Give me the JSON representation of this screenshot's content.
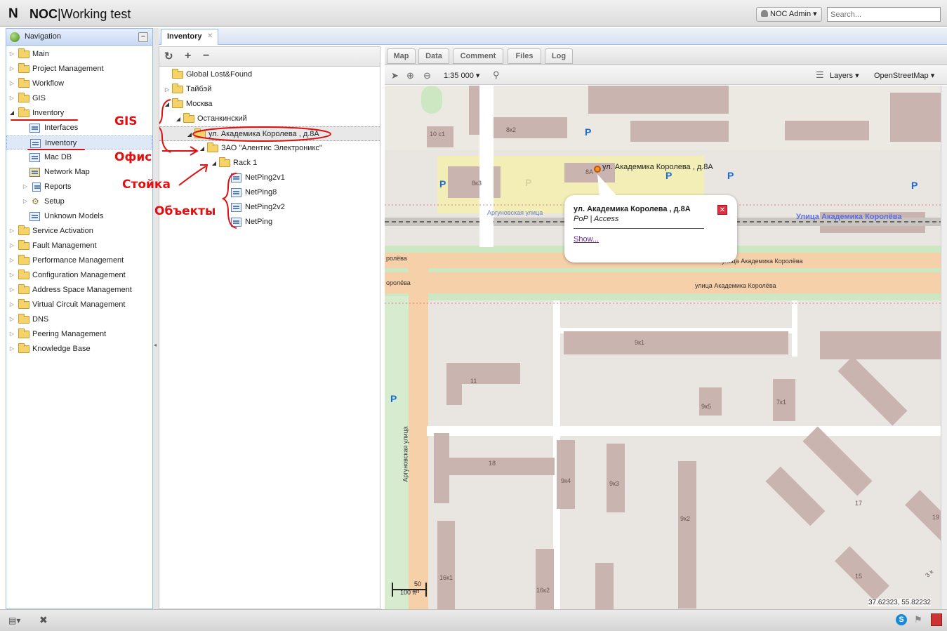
{
  "header": {
    "logo_letter": "N",
    "logo_bold": "NOC",
    "logo_rest": "|Working test",
    "user_label": "NOC Admin ▾",
    "search_placeholder": "Search..."
  },
  "nav": {
    "title": "Navigation",
    "collapse_label": "−",
    "items": [
      {
        "label": "Main"
      },
      {
        "label": "Project Management"
      },
      {
        "label": "Workflow"
      },
      {
        "label": "GIS"
      },
      {
        "label": "Inventory"
      },
      {
        "label": "Interfaces"
      },
      {
        "label": "Inventory"
      },
      {
        "label": "Mac DB"
      },
      {
        "label": "Network Map"
      },
      {
        "label": "Reports"
      },
      {
        "label": "Setup"
      },
      {
        "label": "Unknown Models"
      },
      {
        "label": "Service Activation"
      },
      {
        "label": "Fault Management"
      },
      {
        "label": "Performance Management"
      },
      {
        "label": "Configuration Management"
      },
      {
        "label": "Address Space Management"
      },
      {
        "label": "Virtual Circuit Management"
      },
      {
        "label": "DNS"
      },
      {
        "label": "Peering Management"
      },
      {
        "label": "Knowledge Base"
      }
    ]
  },
  "tab": {
    "label": "Inventory",
    "close": "✕"
  },
  "tree": {
    "tools": {
      "refresh": "↻",
      "add": "+",
      "remove": "−"
    },
    "nodes": [
      {
        "label": "Global Lost&Found"
      },
      {
        "label": "Тайбэй"
      },
      {
        "label": "Москва"
      },
      {
        "label": "Останкинский"
      },
      {
        "label": "ул. Академика Королева , д.8А"
      },
      {
        "label": "ЗАО \"Алентис Электроникс\""
      },
      {
        "label": "Rack 1"
      },
      {
        "label": "NetPing2v1"
      },
      {
        "label": "NetPing8"
      },
      {
        "label": "NetPing2v2"
      },
      {
        "label": "NetPing"
      }
    ]
  },
  "annotations": {
    "gis": "GIS",
    "office": "Офис",
    "rack": "Стойка",
    "objects": "Объекты"
  },
  "right_tabs": [
    "Map",
    "Data",
    "Comment",
    "Files",
    "Log"
  ],
  "map_toolbar": {
    "scale": "1:35 000 ▾",
    "layers": "Layers ▾",
    "base": "OpenStreetMap ▾"
  },
  "map": {
    "labels": {
      "b10c1": "10 с1",
      "b8k2": "8к2",
      "b8k3": "8к3",
      "b8a": "8А",
      "b9k1": "9к1",
      "b11": "11",
      "b9k5": "9к5",
      "b7k1": "7к1",
      "b18": "18",
      "b9k4": "9к4",
      "b9k3": "9к3",
      "b9k2": "9к2",
      "b17": "17",
      "b19": "19",
      "b15": "15",
      "b16k1": "16к1",
      "b16k2": "16к2",
      "b3k": "3 к",
      "street_argun": "Аргуновская улица",
      "street_argun_v": "Аргуновская улица",
      "street_korol_blue": "Улица Академика Королёва",
      "street_korol_1": "улица Академика Королёва",
      "street_korol_2": "улица Академика Королёва",
      "street_korol_left1": "ролёва",
      "street_korol_left2": "оролёва",
      "marker_label": "ул. Академика Королева , д.8А"
    },
    "popup": {
      "title": "ул. Академика Королева , д.8А",
      "subtitle": "PoP | Access",
      "link": "Show..."
    },
    "scalebar": {
      "metric": "50 m",
      "imperial": "100 ft"
    },
    "coords": "37.62323, 55.82232"
  }
}
